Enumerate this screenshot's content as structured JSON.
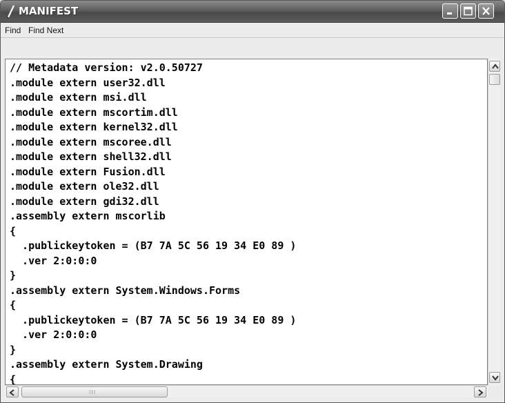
{
  "window": {
    "title": "MANIFEST",
    "app_icon": "notepad-icon",
    "controls": [
      "minimize-icon",
      "maximize-icon",
      "close-icon"
    ]
  },
  "menu": {
    "items": [
      {
        "label": "Find"
      },
      {
        "label": "Find Next"
      }
    ]
  },
  "editor": {
    "lines": [
      "// Metadata version: v2.0.50727",
      ".module extern user32.dll",
      ".module extern msi.dll",
      ".module extern mscortim.dll",
      ".module extern kernel32.dll",
      ".module extern mscoree.dll",
      ".module extern shell32.dll",
      ".module extern Fusion.dll",
      ".module extern ole32.dll",
      ".module extern gdi32.dll",
      ".assembly extern mscorlib",
      "{",
      "  .publickeytoken = (B7 7A 5C 56 19 34 E0 89 )",
      "  .ver 2:0:0:0",
      "}",
      ".assembly extern System.Windows.Forms",
      "{",
      "  .publickeytoken = (B7 7A 5C 56 19 34 E0 89 )",
      "  .ver 2:0:0:0",
      "}",
      ".assembly extern System.Drawing",
      "{"
    ]
  },
  "scrollbars": {
    "vertical_position": 0.0,
    "horizontal_position": 0.0,
    "horizontal_grip": "III"
  }
}
